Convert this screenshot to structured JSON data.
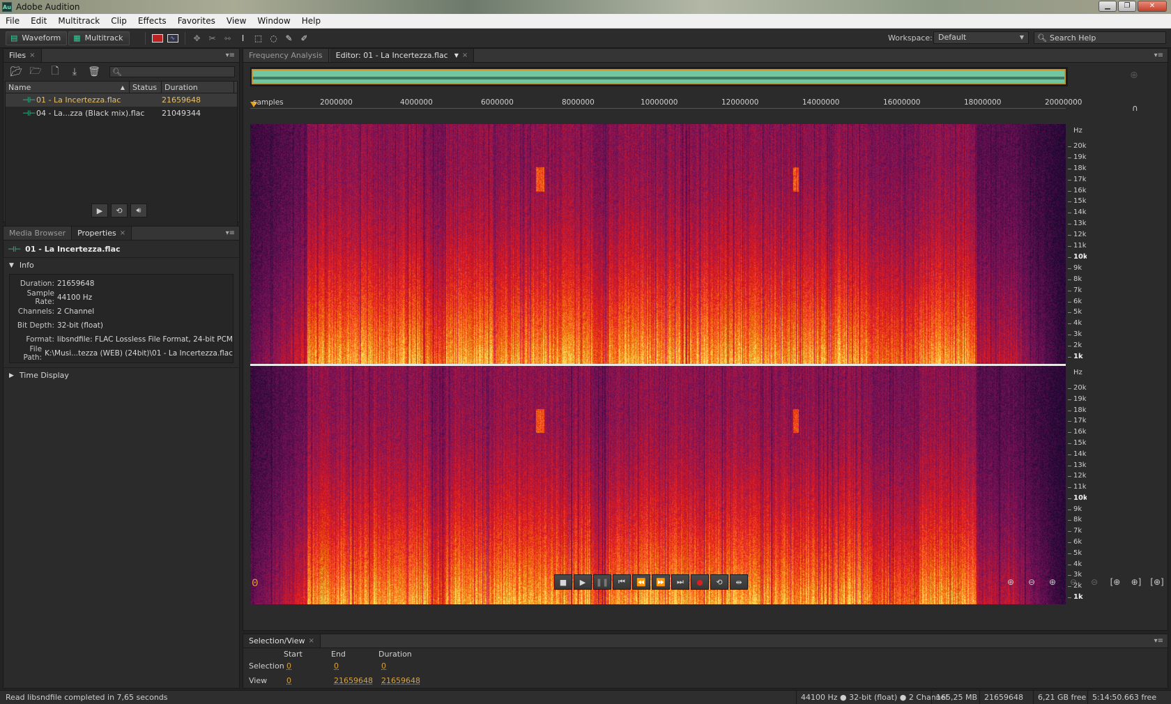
{
  "window": {
    "title": "Adobe Audition",
    "icon_text": "Au"
  },
  "menu": [
    "File",
    "Edit",
    "Multitrack",
    "Clip",
    "Effects",
    "Favorites",
    "View",
    "Window",
    "Help"
  ],
  "toolbar": {
    "waveform_label": "Waveform",
    "multitrack_label": "Multitrack",
    "workspace_label": "Workspace:",
    "workspace_value": "Default",
    "search_placeholder": "Search Help"
  },
  "files_panel": {
    "tab_label": "Files",
    "columns": [
      "Name",
      "Status",
      "Duration"
    ],
    "files": [
      {
        "name": "01 - La Incertezza.flac",
        "status": "",
        "duration": "21659648",
        "selected": true
      },
      {
        "name": "04 - La...zza (Black mix).flac",
        "status": "",
        "duration": "21049344",
        "selected": false
      }
    ]
  },
  "properties_panel": {
    "tabs": [
      "Media Browser",
      "Properties"
    ],
    "file_name": "01 - La Incertezza.flac",
    "info_section": "Info",
    "info": [
      {
        "label": "Duration:",
        "value": "21659648"
      },
      {
        "label": "Sample Rate:",
        "value": "44100 Hz"
      },
      {
        "label": "Channels:",
        "value": "2 Channel"
      },
      {
        "label": "Bit Depth:",
        "value": "32-bit (float)"
      },
      {
        "label": "Format:",
        "value": "libsndfile: FLAC Lossless File Format, 24-bit PCM"
      },
      {
        "label": "File Path:",
        "value": "K:\\Musi...tezza (WEB) (24bit)\\01 - La Incertezza.flac"
      }
    ],
    "time_display_section": "Time Display"
  },
  "editor": {
    "tabs": [
      "Frequency Analysis",
      "Editor: 01 - La Incertezza.flac"
    ],
    "ruler_unit": "samples",
    "ruler_ticks": [
      "2000000",
      "4000000",
      "6000000",
      "8000000",
      "10000000",
      "12000000",
      "14000000",
      "16000000",
      "18000000",
      "20000000"
    ],
    "hz_unit": "Hz",
    "hz_labels": [
      "20k",
      "19k",
      "18k",
      "17k",
      "16k",
      "15k",
      "14k",
      "13k",
      "12k",
      "11k",
      "10k",
      "9k",
      "8k",
      "7k",
      "6k",
      "5k",
      "4k",
      "3k",
      "2k",
      "1k"
    ],
    "time_readout": "0",
    "spectro_colors": {
      "low": "#2a0a3c",
      "mid": "#c3161c",
      "high": "#f6c84a"
    }
  },
  "selection_view": {
    "tab_label": "Selection/View",
    "headers": [
      "Start",
      "End",
      "Duration"
    ],
    "rows": [
      {
        "label": "Selection",
        "start": "0",
        "end": "0",
        "duration": "0"
      },
      {
        "label": "View",
        "start": "0",
        "end": "21659648",
        "duration": "21659648"
      }
    ]
  },
  "status": {
    "message": "Read libsndfile completed in 7,65 seconds",
    "format": "44100 Hz ● 32-bit (float) ● 2 Channel",
    "size": "165,25 MB",
    "duration": "21659648",
    "free_space": "6,21 GB free",
    "free_time": "5:14:50.663 free"
  }
}
